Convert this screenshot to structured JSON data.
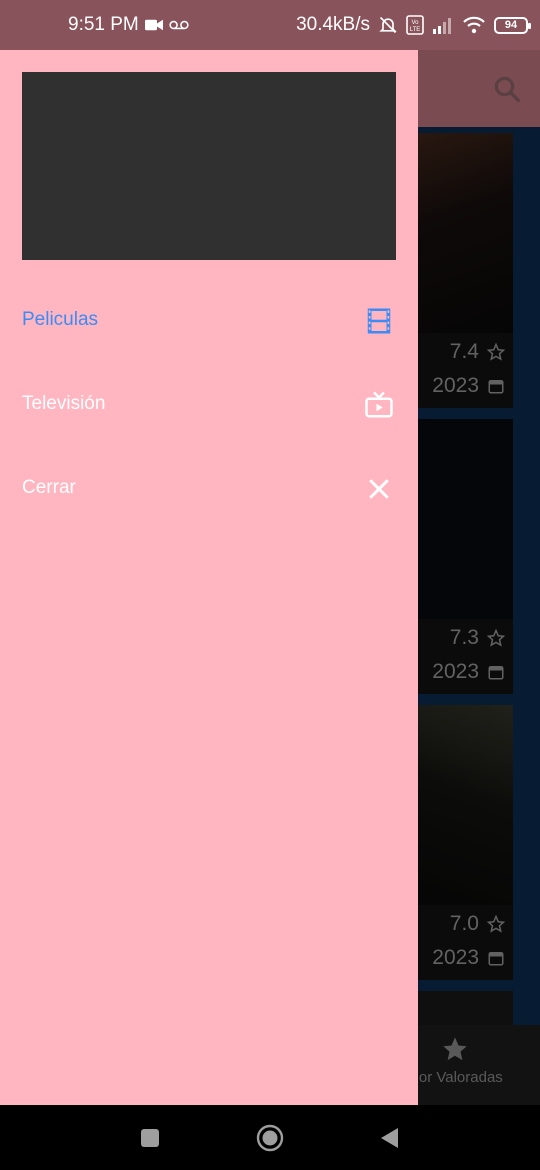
{
  "status_bar": {
    "time": "9:51 PM",
    "speed": "30.4kB/s",
    "battery": "94"
  },
  "drawer": {
    "items": [
      {
        "label": "Peliculas",
        "icon": "movie-icon",
        "active": true
      },
      {
        "label": "Televisión",
        "icon": "tv-icon",
        "active": false
      },
      {
        "label": "Cerrar",
        "icon": "close-icon",
        "active": false
      }
    ]
  },
  "background": {
    "cards": [
      {
        "rating": "7.4",
        "year": "2023"
      },
      {
        "rating": "7.3",
        "year": "2023"
      },
      {
        "rating": "7.0",
        "year": "2023"
      }
    ],
    "bottom_nav": {
      "label": "ejor Valoradas",
      "icon": "star-icon"
    }
  },
  "colors": {
    "drawer_bg": "#ffb6c1",
    "active": "#3d8bf5",
    "header_bg": "#303030"
  }
}
